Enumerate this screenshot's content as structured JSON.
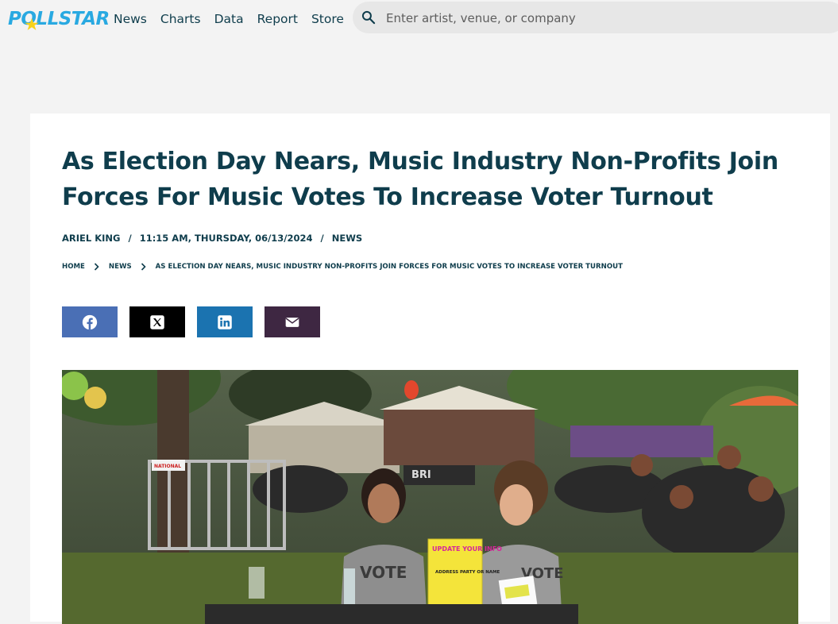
{
  "header": {
    "logo_text": "POLLSTAR",
    "nav": [
      "News",
      "Charts",
      "Data",
      "Report",
      "Store"
    ],
    "search_placeholder": "Enter artist, venue, or company"
  },
  "article": {
    "title": "As Election Day Nears, Music Industry Non-Profits Join Forces For Music Votes To Increase Voter Turnout",
    "author": "ARIEL KING",
    "timestamp": "11:15 AM, THURSDAY, 06/13/2024",
    "category": "NEWS",
    "meta_separator": "/",
    "breadcrumb": [
      "HOME",
      "NEWS",
      "AS ELECTION DAY NEARS, MUSIC INDUSTRY NON-PROFITS JOIN FORCES FOR MUSIC VOTES TO INCREASE VOTER TURNOUT"
    ],
    "share": [
      {
        "name": "facebook",
        "color": "#4a6fb5",
        "icon": "facebook-icon"
      },
      {
        "name": "x",
        "color": "#000000",
        "icon": "x-icon"
      },
      {
        "name": "linkedin",
        "color": "#1b73b0",
        "icon": "linkedin-icon"
      },
      {
        "name": "email",
        "color": "#3e2742",
        "icon": "mail-icon"
      }
    ],
    "hero_image": {
      "sign_title": "UPDATE YOUR INFO",
      "sign_body": "ADDRESS PARTY OR NAME",
      "shirt_text": "VOTE",
      "tent_text": "BRI",
      "barrier_text": "NATIONAL"
    }
  },
  "colors": {
    "brand_blue": "#29a9e1",
    "brand_yellow": "#f8d21b",
    "text_dark": "#0f3d4c",
    "page_bg": "#f3f3f3"
  }
}
